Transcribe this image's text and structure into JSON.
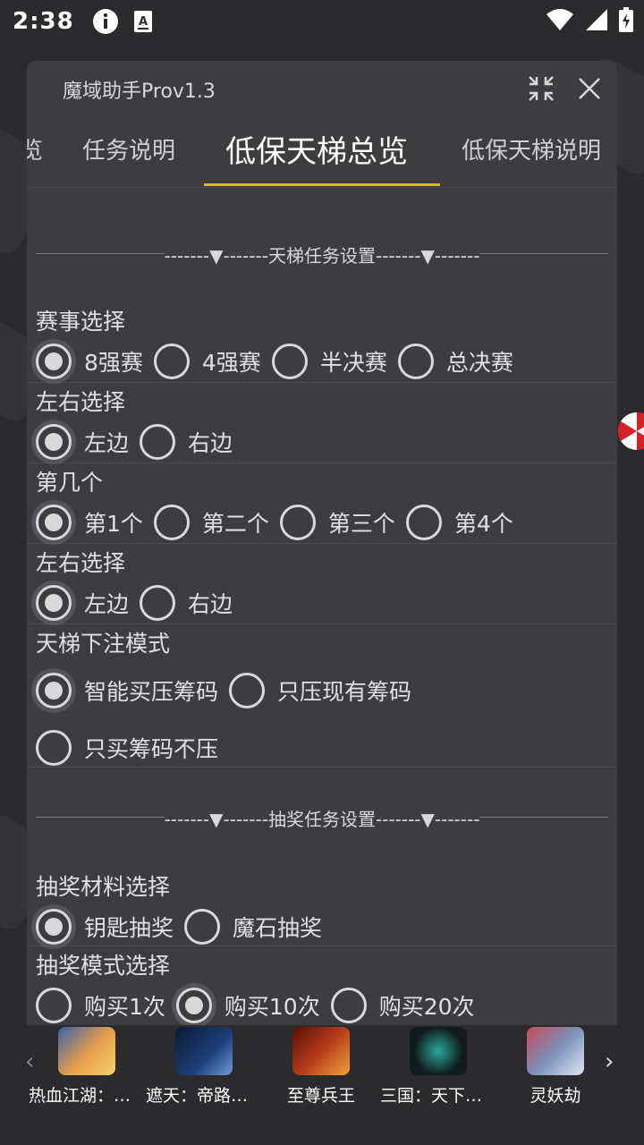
{
  "status_bar": {
    "time": "2:38",
    "icons": [
      "info-icon",
      "a-box-icon"
    ],
    "right_icons": [
      "wifi-icon",
      "signal-icon",
      "battery-icon"
    ]
  },
  "window": {
    "title": "魔域助手Prov1.3",
    "tabs": [
      {
        "label": "览"
      },
      {
        "label": "任务说明"
      },
      {
        "label": "低保天梯总览",
        "active": true
      },
      {
        "label": "低保天梯说明"
      }
    ],
    "accent": "#e8b432"
  },
  "sections": {
    "ladder_divider": "-------▼-------天梯任务设置-------▼-------",
    "lottery_divider": "-------▼-------抽奖任务设置-------▼-------"
  },
  "groups": [
    {
      "title": "赛事选择",
      "options": [
        "8强赛",
        "4强赛",
        "半决赛",
        "总决赛"
      ],
      "selected": 0
    },
    {
      "title": "左右选择",
      "options": [
        "左边",
        "右边"
      ],
      "selected": 0
    },
    {
      "title": "第几个",
      "options": [
        "第1个",
        "第二个",
        "第三个",
        "第4个"
      ],
      "selected": 0
    },
    {
      "title": "左右选择",
      "options": [
        "左边",
        "右边"
      ],
      "selected": 0
    },
    {
      "title": "天梯下注模式",
      "options": [
        "智能买压筹码",
        "只压现有筹码",
        "只买筹码不压"
      ],
      "selected": 0
    },
    {
      "title": "抽奖材料选择",
      "options": [
        "钥匙抽奖",
        "魔石抽奖"
      ],
      "selected": 0
    },
    {
      "title": "抽奖模式选择",
      "options": [
        "购买1次",
        "购买10次",
        "购买20次"
      ],
      "selected": 1
    }
  ],
  "bottom_bar": {
    "prev_arrow": "‹",
    "next_arrow": "›",
    "games": [
      {
        "name": "热血江湖：归...",
        "color": "#e9a04a"
      },
      {
        "name": "遮天：帝路争...",
        "color": "#1c3f7a"
      },
      {
        "name": "至尊兵王",
        "color": "#b33a1a"
      },
      {
        "name": "三国：天下归...",
        "color": "#111a1c"
      },
      {
        "name": "灵妖劫",
        "color": "#7a8fb8"
      }
    ]
  }
}
